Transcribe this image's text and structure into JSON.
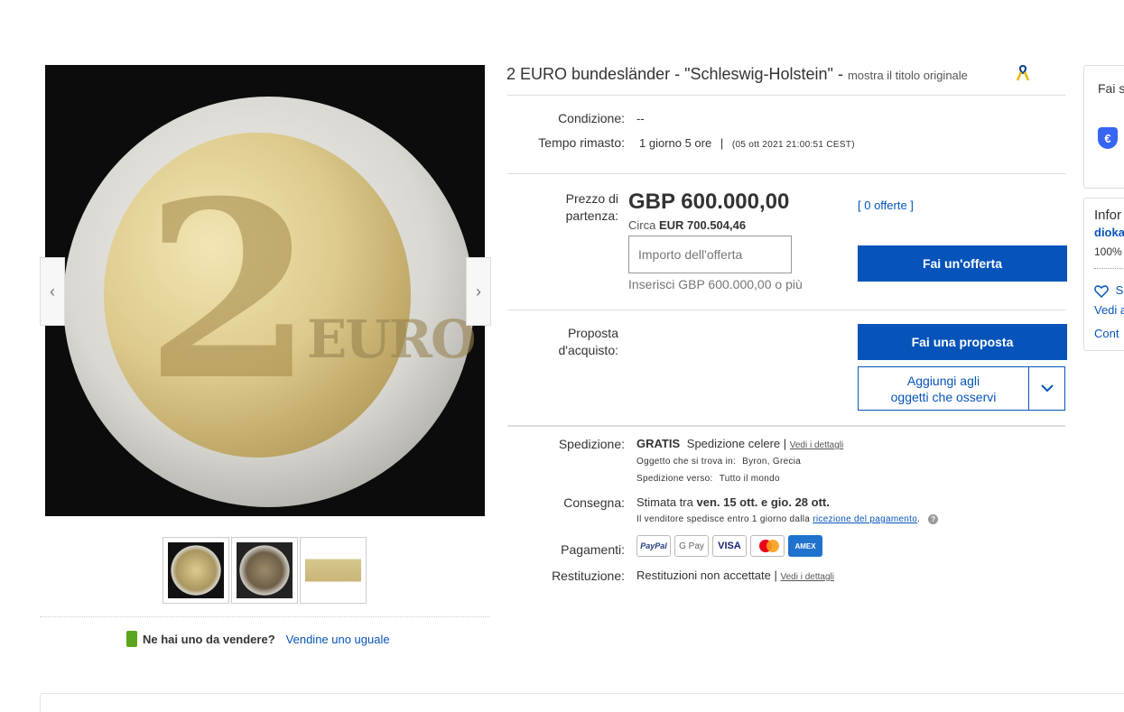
{
  "listing": {
    "title": "2 EURO bundesländer - \"Schleswig-Holstein\" -",
    "show_original": "mostra il titolo originale"
  },
  "gallery": {
    "coin_denomination": "2",
    "coin_text": "EURO",
    "prev_icon": "chevron-left-icon",
    "next_icon": "chevron-right-icon",
    "thumbnails": [
      "coin-front",
      "coin-back",
      "coin-detail"
    ]
  },
  "sell": {
    "question": "Ne hai uno da vendere?",
    "link": "Vendine uno uguale"
  },
  "details": {
    "condition_label": "Condizione:",
    "condition_value": "--",
    "time_label": "Tempo rimasto:",
    "time_value": "1 giorno 5 ore",
    "time_sep": "|",
    "time_end": "(05 ott 2021   21:00:51 CEST)"
  },
  "price": {
    "label_line1": "Prezzo di",
    "label_line2": "partenza:",
    "amount": "GBP 600.000,00",
    "approx_prefix": "Circa",
    "approx_amount": "EUR 700.504,46",
    "offers_link": "[ 0 offerte ]",
    "bid_placeholder": "Importo dell'offerta",
    "bid_hint": "Inserisci GBP 600.000,00 o più",
    "bid_button": "Fai un'offerta"
  },
  "proposal": {
    "label_line1": "Proposta",
    "label_line2": "d'acquisto:",
    "button": "Fai una proposta",
    "watch_line1": "Aggiungi agli",
    "watch_line2": "oggetti che osservi",
    "watch_drop_icon": "chevron-down-icon"
  },
  "shipping": {
    "label": "Spedizione:",
    "free": "GRATIS",
    "method": "Spedizione celere |",
    "details_link": "Vedi i dettagli",
    "location_label": "Oggetto che si trova in:",
    "location_value": "Byron, Grecia",
    "to_label": "Spedizione verso:",
    "to_value": "Tutto il mondo"
  },
  "delivery": {
    "label": "Consegna:",
    "prefix": "Stimata tra",
    "range": "ven. 15 ott. e gio. 28 ott.",
    "note": "Il venditore spedisce entro 1 giorno dalla",
    "note_link": "ricezione del pagamento",
    "note_end": "."
  },
  "payments": {
    "label": "Pagamenti:",
    "methods": [
      "PayPal",
      "G Pay",
      "VISA",
      "",
      "AMEX"
    ]
  },
  "returns": {
    "label": "Restituzione:",
    "value": "Restituzioni non accettate |",
    "details_link": "Vedi i dettagli"
  },
  "right_panel": {
    "box1_title": "Fai s",
    "box2_title": "Infor",
    "seller": "dioka",
    "feedback": "100%",
    "save_seller": "S",
    "see_other": "Vedi a",
    "contact": "Cont"
  },
  "colors": {
    "primary": "#0654ba",
    "text": "#333333",
    "muted": "#767676"
  }
}
